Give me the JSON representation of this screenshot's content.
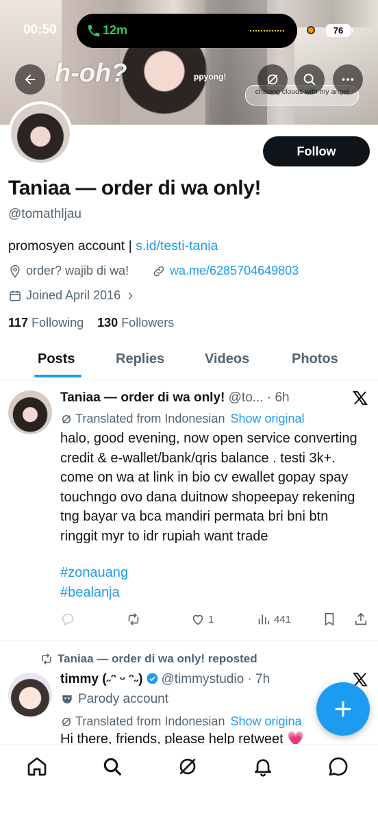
{
  "status": {
    "time": "00:50",
    "call_timer": "12m",
    "battery": "76"
  },
  "banner": {
    "uhoh": "h-oh?",
    "ppyong": "ppyong!",
    "caption": "chasing clouds with my angel"
  },
  "profile": {
    "name": "Taniaa — order di wa only!",
    "handle": "@tomathljau",
    "follow_label": "Follow",
    "bio_text": "promosyen account | ",
    "bio_link": "s.id/testi-tania",
    "location": "order? wajib di wa!",
    "website": "wa.me/6285704649803",
    "joined": "Joined April 2016",
    "following_count": "117",
    "following_label": "Following",
    "followers_count": "130",
    "followers_label": "Followers"
  },
  "tabs": [
    {
      "label": "Posts",
      "active": true
    },
    {
      "label": "Replies",
      "active": false
    },
    {
      "label": "Videos",
      "active": false
    },
    {
      "label": "Photos",
      "active": false
    }
  ],
  "tweet1": {
    "name": "Taniaa — order di wa only!",
    "handle_time": " @to... · 6h",
    "translated": "Translated from Indonesian",
    "show_original": "Show original",
    "text": "halo, good evening, now open service converting credit & e-wallet/bank/qris balance . testi 3k+. come on wa at link in bio cv ewallet gopay spay touchngo ovo dana duitnow shopeepay rekening tng bayar va bca mandiri permata bri bni btn ringgit myr to idr rupiah want trade",
    "hashtag1": "#zonauang",
    "hashtag2": "#bealanja",
    "likes": "1",
    "views": "441"
  },
  "tweet2": {
    "repost_label": "Taniaa — order di wa only! reposted",
    "name": "timmy (˶ᵔ ᵕ ᵔ˶)",
    "handle_time": "@timmystudio · 7h",
    "parody": "Parody account",
    "translated": "Translated from Indonesian",
    "show_original": "Show origina",
    "text": "Hi there, friends, please help retweet 💗"
  },
  "icons": {
    "back": "arrow-left-icon",
    "grok": "grok-icon",
    "search": "search-icon",
    "more": "more-icon",
    "location": "location-pin-icon",
    "link": "link-icon",
    "calendar": "calendar-icon",
    "reply": "reply-icon",
    "repost": "repost-icon",
    "like": "heart-icon",
    "views": "views-icon",
    "bookmark": "bookmark-icon",
    "share": "share-icon",
    "compose": "plus-icon",
    "home": "home-icon",
    "notifications": "bell-icon",
    "messages": "message-icon"
  },
  "colors": {
    "accent": "#1d9bf0",
    "text": "#0f1419",
    "muted": "#536471"
  }
}
